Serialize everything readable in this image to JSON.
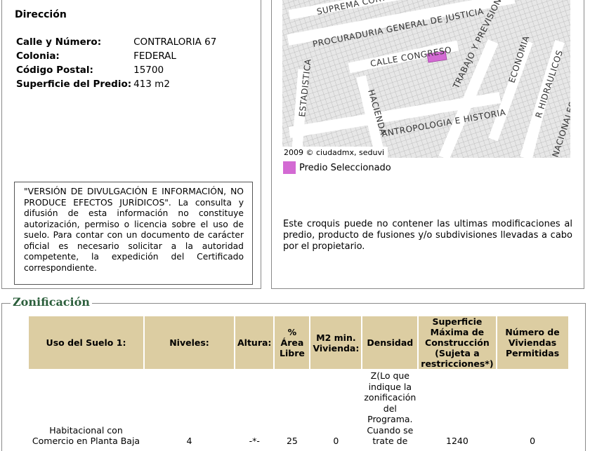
{
  "direccion": {
    "title": "Dirección",
    "fields": [
      {
        "label": "Calle y Número:",
        "value": "CONTRALORIA 67"
      },
      {
        "label": "Colonia:",
        "value": "FEDERAL"
      },
      {
        "label": "Código Postal:",
        "value": "15700"
      },
      {
        "label": "Superficie del Predio:",
        "value": "413 m2"
      }
    ]
  },
  "notice": "\"VERSIÓN DE DIVULGACIÓN E INFORMACIÓN, NO PRODUCE EFECTOS JURÍDICOS\". La consulta y difusión de esta información no constituye autorización, permiso o licencia sobre el uso de suelo. Para contar con un documento de carácter oficial es necesario solicitar a la autoridad competente, la expedición del Certificado correspondiente.",
  "map": {
    "streets": [
      "SUPREMA CORTE",
      "PROCURADURIA GENERAL DE JUSTICIA",
      "CALLE CONGRESO",
      "TRABAJO Y PREVISION SOCIAL",
      "ECONOMIA",
      "R HIDRAULICOS",
      "ESTADISTICA",
      "HACIENDA",
      "ANTROPOLOGIA E HISTORIA",
      "NACIONALES"
    ],
    "copyright": "2009 © ciudadmx, seduvi",
    "highlight_color": "#d36ad3"
  },
  "legend": {
    "label": "Predio Seleccionado",
    "color": "#d36ad3"
  },
  "croquis_note": "Este croquis puede no contener las ultimas modificaciones al predio, producto de fusiones y/o subdivisiones llevadas a cabo por el propietario.",
  "zonificacion": {
    "title": "Zonificación",
    "header_color": "#dccda2",
    "headers": [
      "Uso del Suelo 1:",
      "Niveles:",
      "Altura:",
      "% Área Libre",
      "M2 min. Vivienda:",
      "Densidad",
      "Superficie Máxima de Construcción (Sujeta a restricciones*)",
      "Número de Viviendas Permitidas"
    ],
    "row": {
      "uso": "Habitacional con Comercio en Planta Baja",
      "niveles": "4",
      "altura": "-*-",
      "area_libre": "25",
      "m2_min": "0",
      "densidad": "Z(Lo que indique la zonificación del Programa. Cuando se trate de",
      "superficie_max": "1240",
      "num_viviendas": "0"
    }
  }
}
